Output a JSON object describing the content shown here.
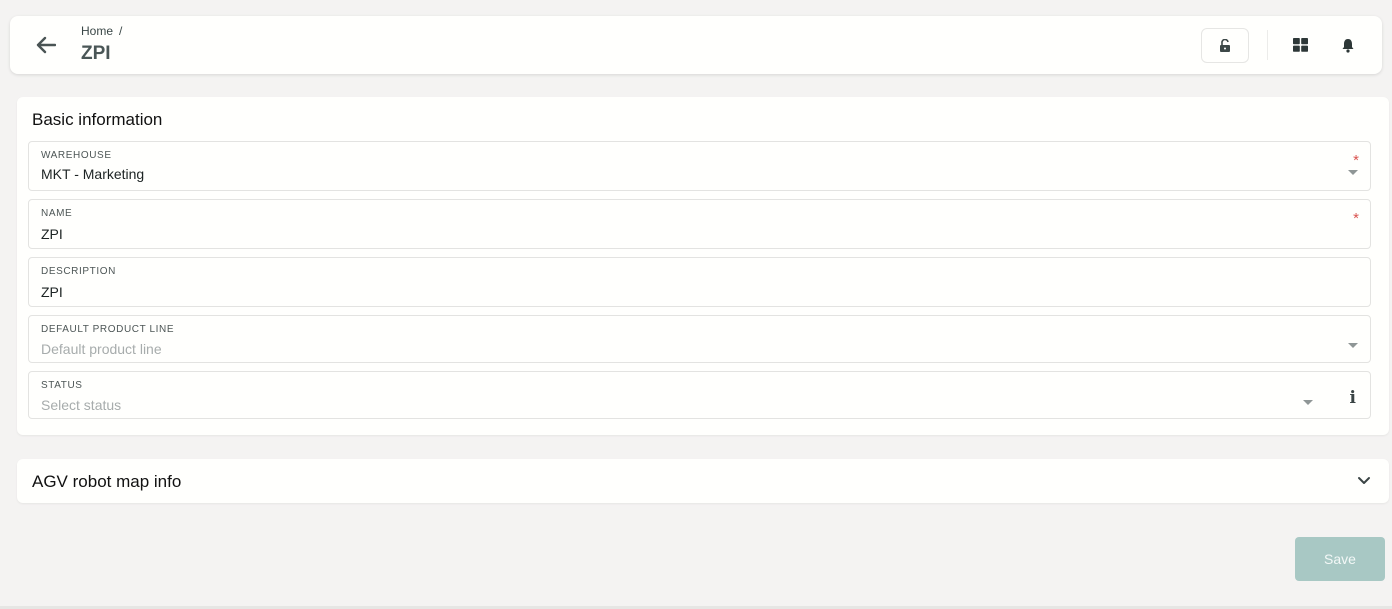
{
  "header": {
    "breadcrumb": [
      "Home",
      "/"
    ],
    "title": "ZPI",
    "icons": {
      "back": "arrow-left-icon",
      "lock": "unlock-icon",
      "grid": "grid-icon",
      "bell": "bell-icon"
    }
  },
  "basic_info": {
    "title": "Basic information",
    "fields": {
      "warehouse": {
        "label": "WAREHOUSE",
        "value": "MKT - Marketing",
        "required": "*"
      },
      "name": {
        "label": "NAME",
        "value": "ZPI",
        "required": "*"
      },
      "description": {
        "label": "DESCRIPTION",
        "value": "ZPI"
      },
      "product_line": {
        "label": "DEFAULT PRODUCT LINE",
        "placeholder": "Default product line"
      },
      "status": {
        "label": "STATUS",
        "placeholder": "Select status",
        "info_icon": "i"
      }
    }
  },
  "agv_section": {
    "title": "AGV robot map info"
  },
  "actions": {
    "save_label": "Save"
  },
  "colors": {
    "background": "#f4f3f2",
    "card": "#fffffd",
    "save_button": "#a8c8c4",
    "required": "#d9534f"
  }
}
